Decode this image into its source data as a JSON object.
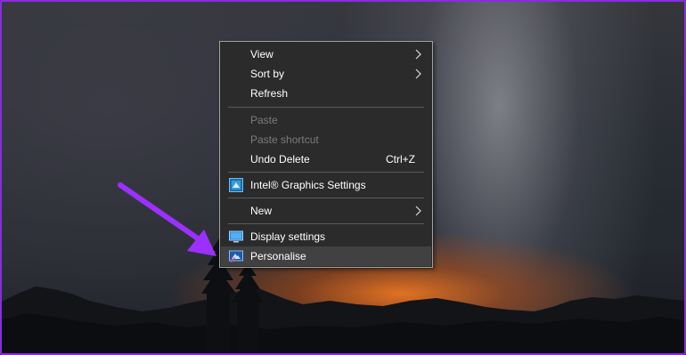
{
  "context_menu": {
    "items": [
      {
        "label": "View",
        "has_submenu": true
      },
      {
        "label": "Sort by",
        "has_submenu": true
      },
      {
        "label": "Refresh"
      },
      {
        "label": "Paste",
        "disabled": true
      },
      {
        "label": "Paste shortcut",
        "disabled": true
      },
      {
        "label": "Undo Delete",
        "shortcut": "Ctrl+Z"
      },
      {
        "label": "Intel® Graphics Settings",
        "icon": "intel-graphics-icon"
      },
      {
        "label": "New",
        "has_submenu": true
      },
      {
        "label": "Display settings",
        "icon": "display-icon"
      },
      {
        "label": "Personalise",
        "icon": "personalise-icon",
        "highlighted": true
      }
    ]
  },
  "annotation": {
    "arrow_color": "#9b30ff",
    "arrow_icon": "pointer-arrow-icon"
  },
  "colors": {
    "menu_bg": "#2b2b2b",
    "menu_border": "#a0a0a0",
    "highlight": "#414141",
    "frame": "#8a2be2"
  }
}
